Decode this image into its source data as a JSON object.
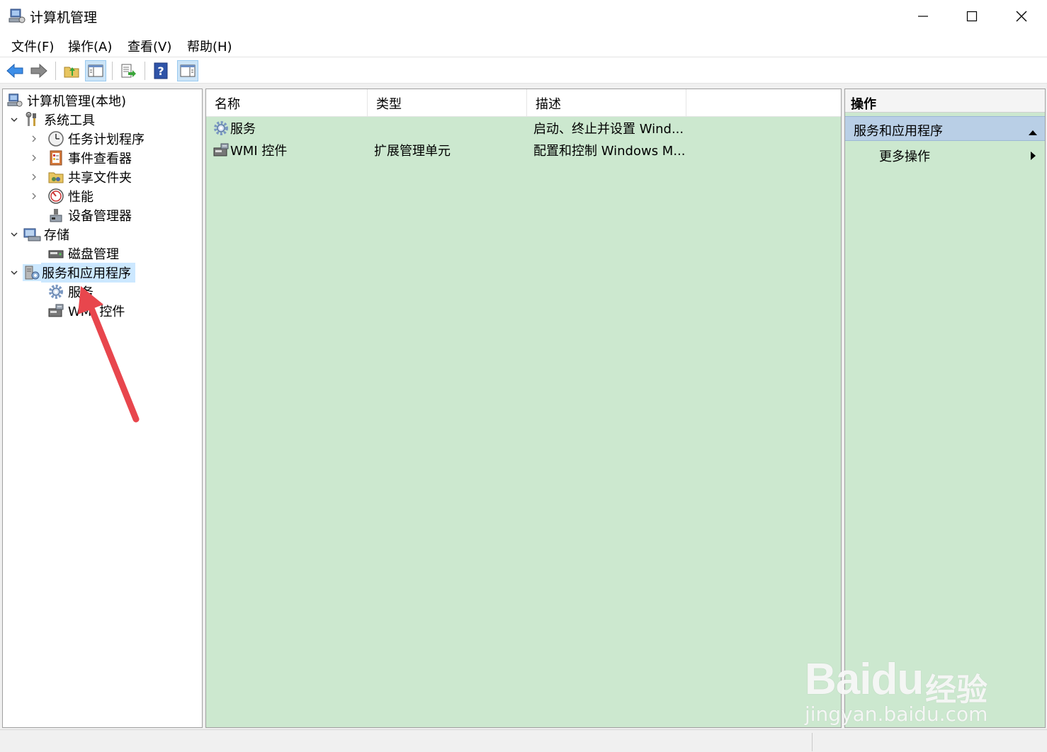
{
  "window": {
    "title": "计算机管理",
    "controls": [
      "minimize",
      "maximize",
      "close"
    ]
  },
  "menu": {
    "items": [
      {
        "label": "文件(F)"
      },
      {
        "label": "操作(A)"
      },
      {
        "label": "查看(V)"
      },
      {
        "label": "帮助(H)"
      }
    ]
  },
  "toolbar": {
    "buttons": [
      "back-icon",
      "forward-icon",
      "up-folder-icon",
      "show-console-tree-icon",
      "export-list-icon",
      "help-icon",
      "show-action-pane-icon"
    ]
  },
  "tree": {
    "items": [
      {
        "label": "计算机管理(本地)",
        "icon": "computer-management-icon",
        "expander": "none"
      },
      {
        "label": "系统工具",
        "icon": "system-tools-icon",
        "expander": "expanded"
      },
      {
        "label": "任务计划程序",
        "icon": "task-scheduler-icon",
        "expander": "collapsed"
      },
      {
        "label": "事件查看器",
        "icon": "event-viewer-icon",
        "expander": "collapsed"
      },
      {
        "label": "共享文件夹",
        "icon": "shared-folders-icon",
        "expander": "collapsed"
      },
      {
        "label": "性能",
        "icon": "performance-icon",
        "expander": "collapsed"
      },
      {
        "label": "设备管理器",
        "icon": "device-manager-icon",
        "expander": "none"
      },
      {
        "label": "存储",
        "icon": "storage-icon",
        "expander": "expanded"
      },
      {
        "label": "磁盘管理",
        "icon": "disk-management-icon",
        "expander": "none"
      },
      {
        "label": "服务和应用程序",
        "icon": "services-applications-icon",
        "expander": "expanded",
        "selected": true
      },
      {
        "label": "服务",
        "icon": "services-gear-icon",
        "expander": "none"
      },
      {
        "label": "WMI 控件",
        "icon": "wmi-control-icon",
        "expander": "none"
      }
    ]
  },
  "list": {
    "columns": [
      {
        "label": "名称"
      },
      {
        "label": "类型"
      },
      {
        "label": "描述"
      }
    ],
    "rows": [
      {
        "name": "服务",
        "type": "",
        "description": "启动、终止并设置 Wind...",
        "icon": "services-gear-icon"
      },
      {
        "name": "WMI 控件",
        "type": "扩展管理单元",
        "description": "配置和控制 Windows M...",
        "icon": "wmi-control-icon"
      }
    ]
  },
  "actions": {
    "title": "操作",
    "section": "服务和应用程序",
    "items": [
      {
        "label": "更多操作"
      }
    ]
  },
  "watermark": {
    "brand": "Bai",
    "brand_paw": "du",
    "cn": "经验",
    "url": "jingyan.baidu.com"
  },
  "colors": {
    "pane_background": "#cce8cf",
    "selection": "#cce8ff",
    "actions_section": "#b9cfe6",
    "annotation_arrow": "#e8464d"
  }
}
